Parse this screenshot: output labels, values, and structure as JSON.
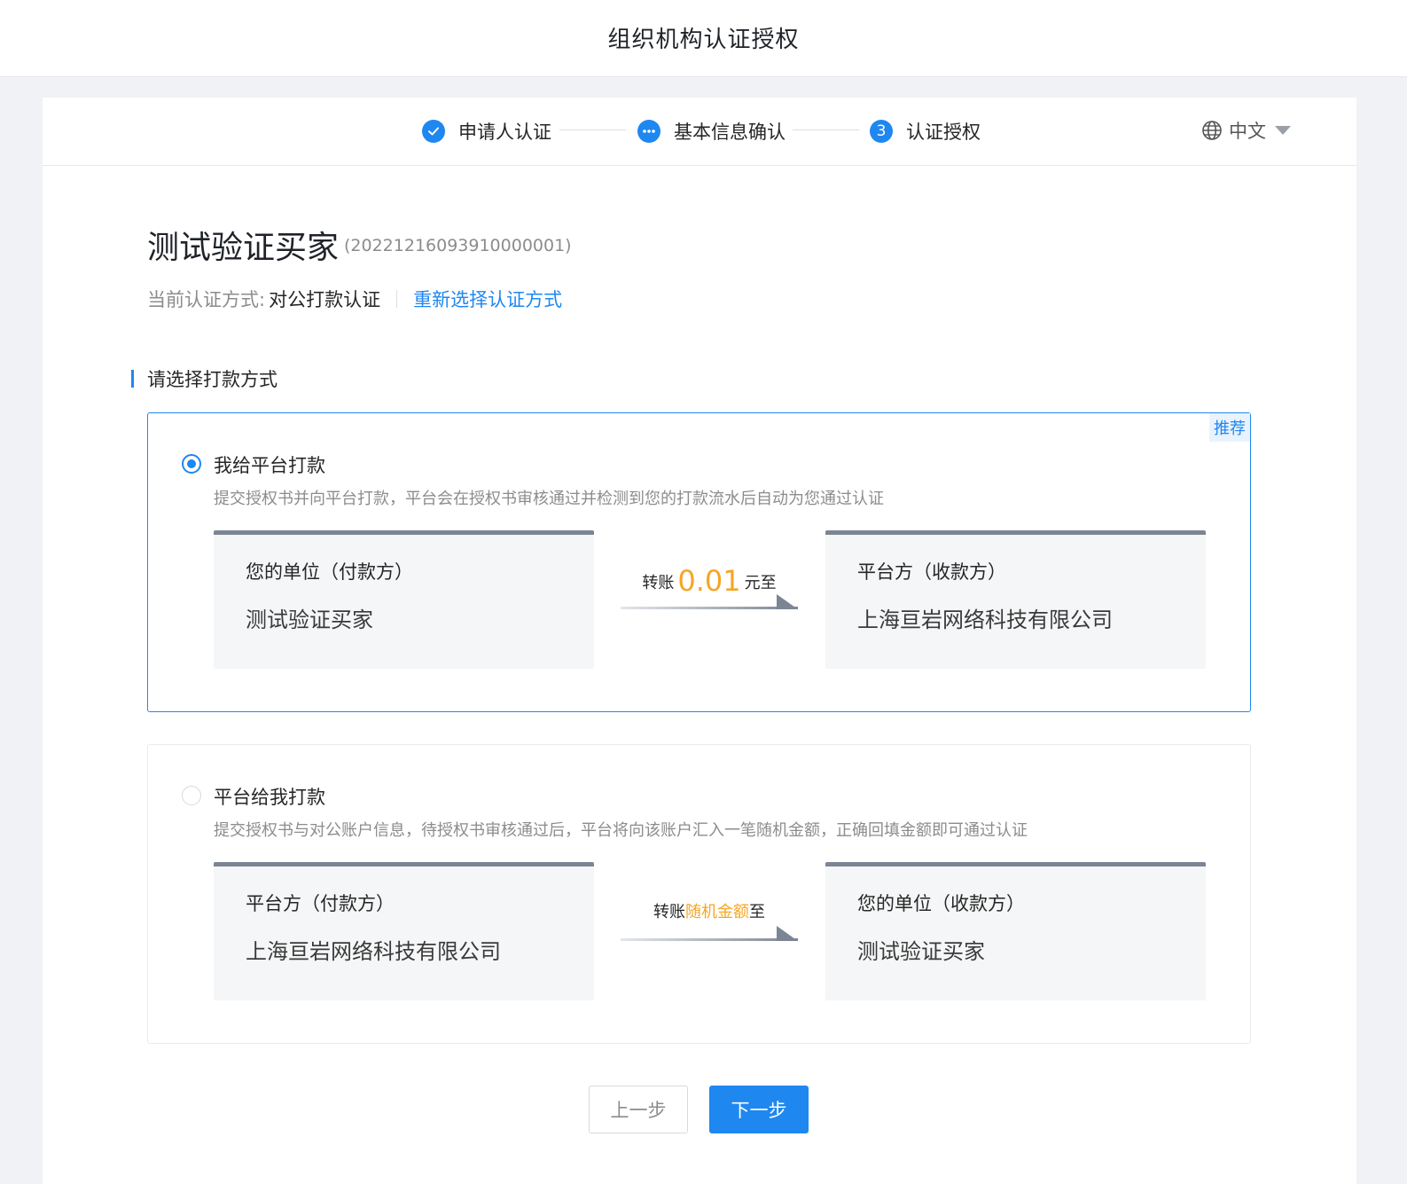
{
  "header": {
    "title": "组织机构认证授权"
  },
  "steps": [
    {
      "label": "申请人认证",
      "status": "done"
    },
    {
      "label": "基本信息确认",
      "status": "in-progress"
    },
    {
      "label": "认证授权",
      "number": "3",
      "status": "current"
    }
  ],
  "language": {
    "label": "中文",
    "icon": "globe-icon"
  },
  "org": {
    "name": "测试验证买家",
    "id": "(20221216093910000001)",
    "current_mode_key": "当前认证方式:",
    "current_mode_value": "对公打款认证",
    "reselect_link": "重新选择认证方式"
  },
  "section": {
    "title": "请选择打款方式"
  },
  "options": [
    {
      "selected": true,
      "tag": "推荐",
      "title": "我给平台打款",
      "desc": "提交授权书并向平台打款，平台会在授权书审核通过并检测到您的打款流水后自动为您通过认证",
      "from": {
        "role": "您的单位（付款方）",
        "name": "测试验证买家"
      },
      "transfer": {
        "prefix": "转账",
        "amount": "0.01",
        "suffix": "元至"
      },
      "to": {
        "role": "平台方（收款方）",
        "name": "上海亘岩网络科技有限公司"
      }
    },
    {
      "selected": false,
      "title": "平台给我打款",
      "desc": "提交授权书与对公账户信息，待授权书审核通过后，平台将向该账户汇入一笔随机金额，正确回填金额即可通过认证",
      "from": {
        "role": "平台方（付款方）",
        "name": "上海亘岩网络科技有限公司"
      },
      "transfer": {
        "prefix": "转账",
        "highlight": "随机金额",
        "suffix": "至"
      },
      "to": {
        "role": "您的单位（收款方）",
        "name": "测试验证买家"
      }
    }
  ],
  "buttons": {
    "prev": "上一步",
    "next": "下一步"
  },
  "colors": {
    "accent": "#1f87f0",
    "highlight": "#f5a623"
  }
}
